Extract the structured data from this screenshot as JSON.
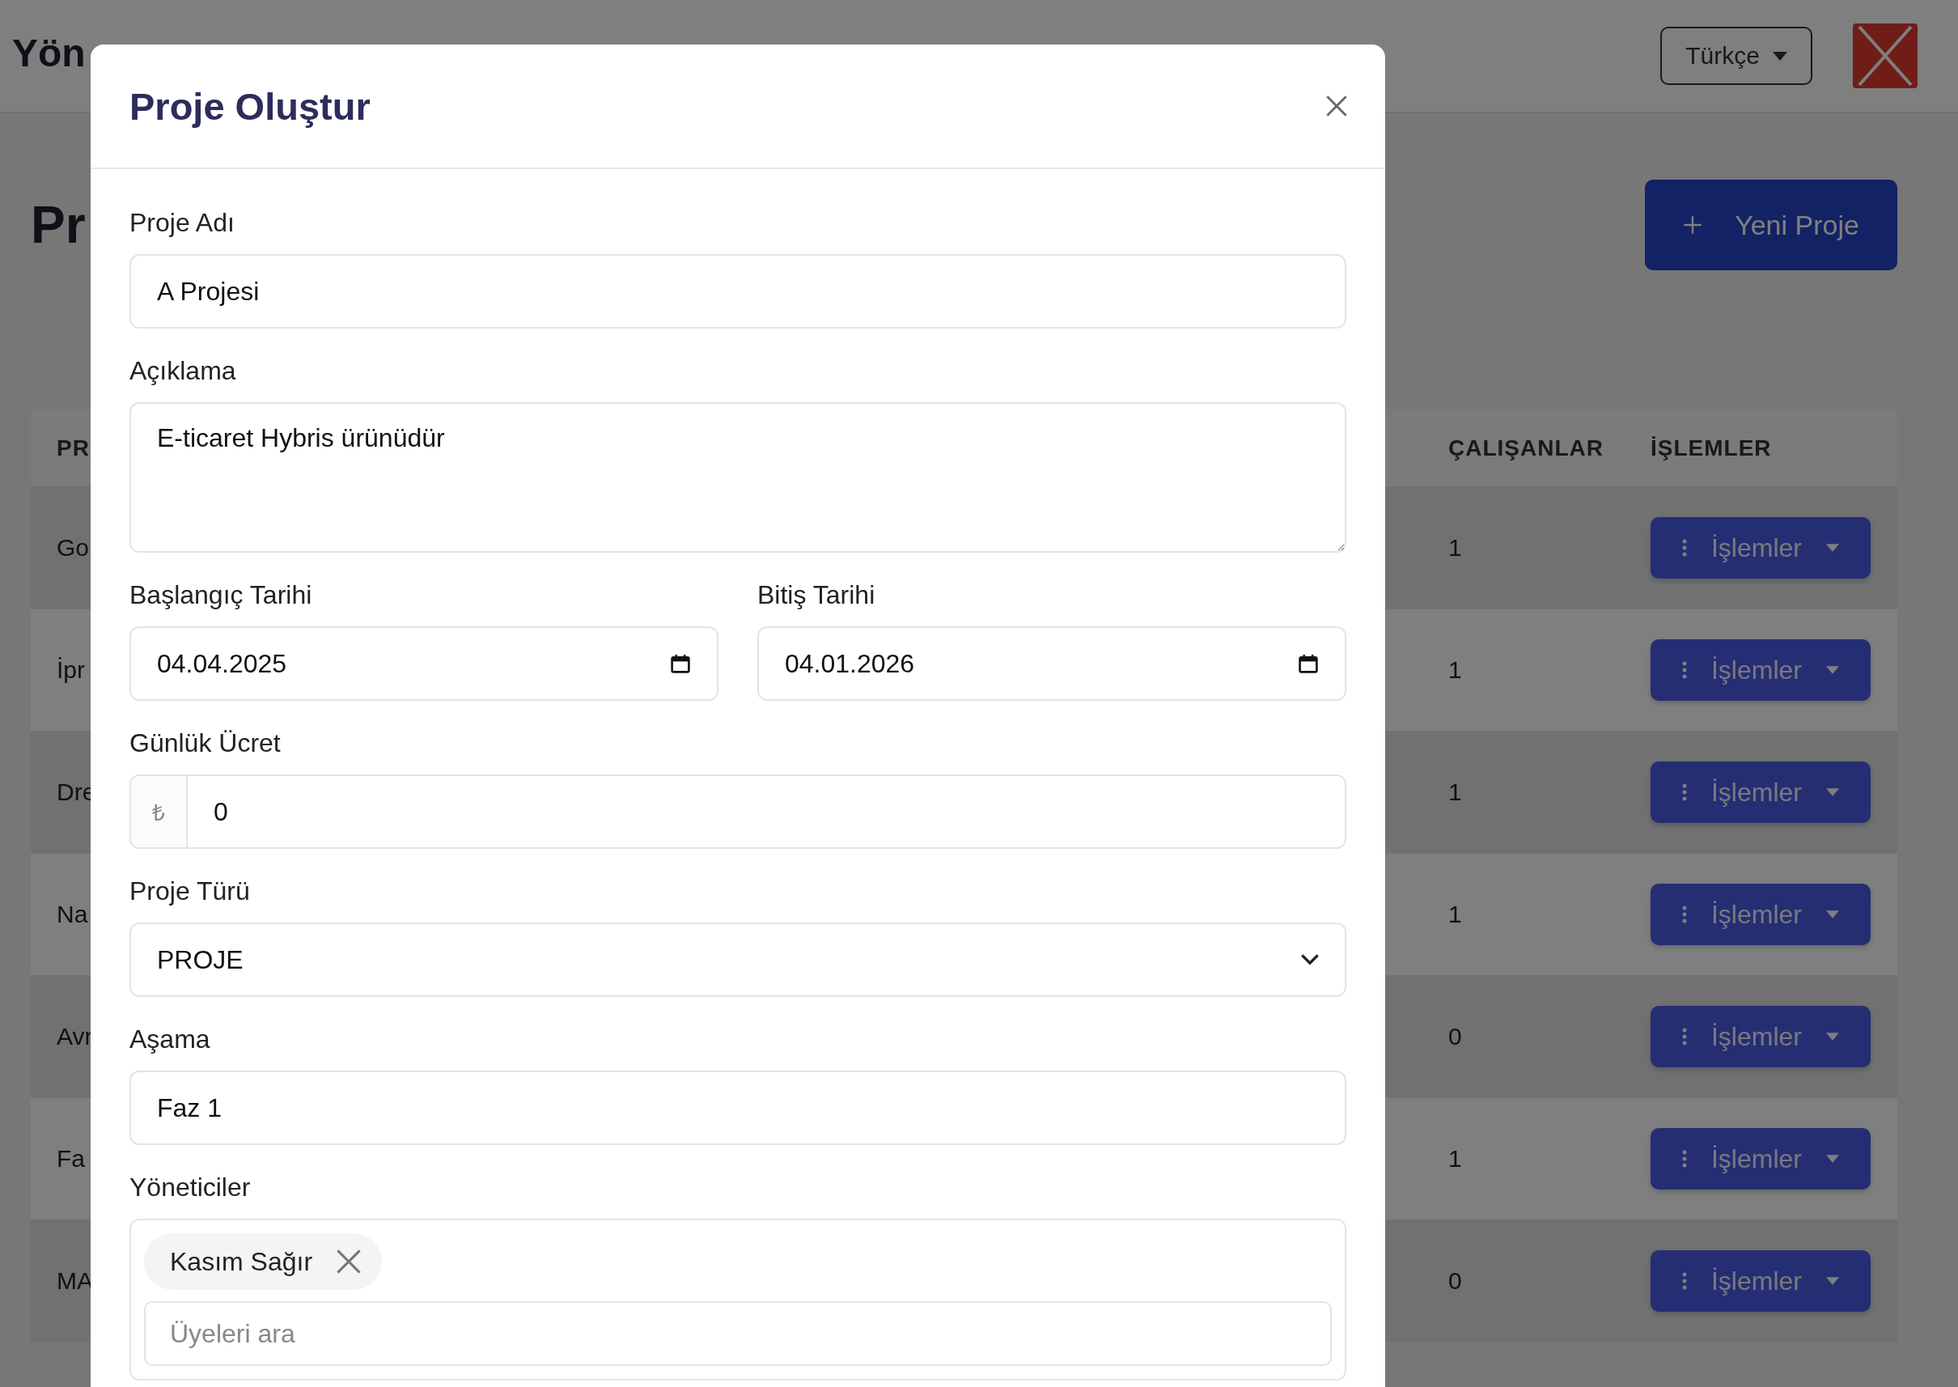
{
  "header": {
    "title": "Yön",
    "language": "Türkçe"
  },
  "page": {
    "title": "Pr",
    "new_button": "Yeni Proje"
  },
  "table": {
    "columns": [
      "PR",
      "ÇALIŞANLAR",
      "İŞLEMLER"
    ],
    "rows": [
      {
        "name": "Go",
        "employees": "1",
        "action": "İşlemler"
      },
      {
        "name": "İpr",
        "employees": "1",
        "action": "İşlemler"
      },
      {
        "name": "Dre",
        "employees": "1",
        "action": "İşlemler"
      },
      {
        "name": "Na",
        "employees": "1",
        "action": "İşlemler"
      },
      {
        "name": "Avr",
        "employees": "0",
        "action": "İşlemler"
      },
      {
        "name": "Fa",
        "employees": "1",
        "action": "İşlemler"
      },
      {
        "name": "MA",
        "employees": "0",
        "action": "İşlemler"
      }
    ]
  },
  "modal": {
    "title": "Proje Oluştur",
    "fields": [
      {
        "kind": "text",
        "label": "Proje Adı",
        "value": "A Projesi"
      },
      {
        "kind": "textarea",
        "label": "Açıklama",
        "value": "E-ticaret Hybris ürünüdür"
      },
      {
        "kind": "dates",
        "items": [
          {
            "label": "Başlangıç Tarihi",
            "value": "04.04.2025"
          },
          {
            "label": "Bitiş Tarihi",
            "value": "04.01.2026"
          }
        ]
      },
      {
        "kind": "currency",
        "label": "Günlük Ücret",
        "symbol": "₺",
        "value": "0"
      },
      {
        "kind": "select",
        "label": "Proje Türü",
        "value": "PROJE"
      },
      {
        "kind": "text",
        "label": "Aşama",
        "value": "Faz 1"
      },
      {
        "kind": "tags",
        "label": "Yöneticiler",
        "tags": [
          "Kasım Sağır"
        ],
        "placeholder": "Üyeleri ara"
      }
    ]
  }
}
